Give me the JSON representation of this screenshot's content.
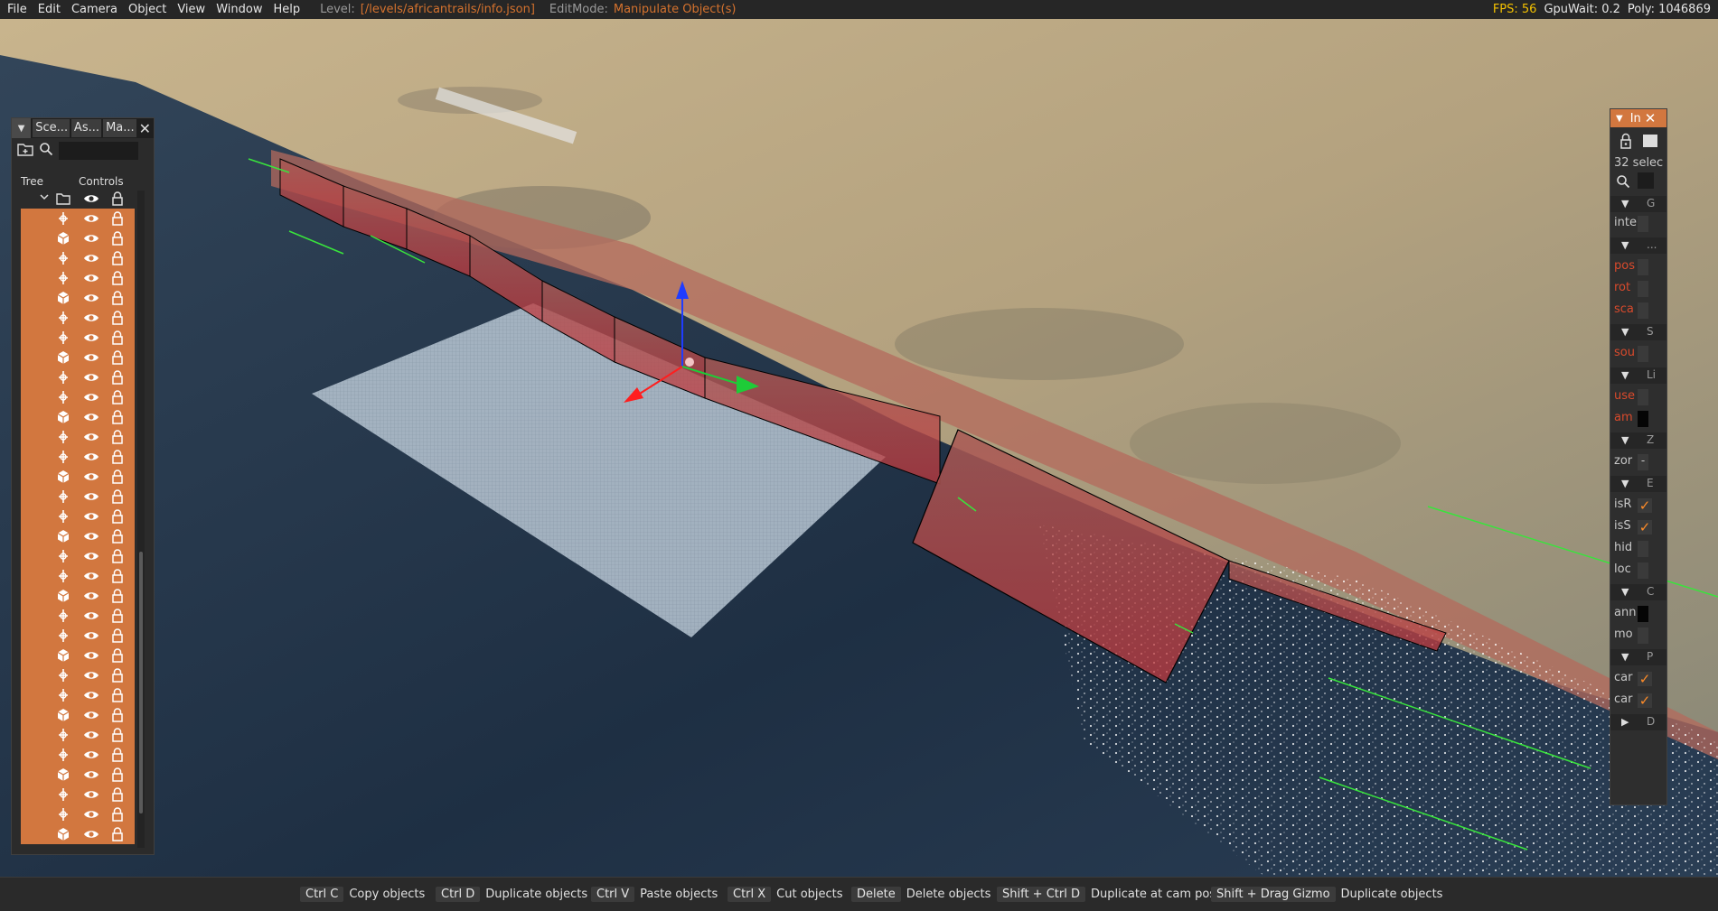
{
  "menu": {
    "items": [
      "File",
      "Edit",
      "Camera",
      "Object",
      "View",
      "Window",
      "Help"
    ],
    "level_label": "Level:",
    "level_value": "[/levels/africantrails/info.json]",
    "editmode_label": "EditMode:",
    "editmode_value": "Manipulate Object(s)"
  },
  "stats": {
    "fps_label": "FPS: 56",
    "gpuwait": "GpuWait: 0.2",
    "poly": "Poly: 1046869"
  },
  "scene_tree": {
    "tabs": [
      "Sce...",
      "As...",
      "Ma..."
    ],
    "columns": [
      "Tree",
      "Controls"
    ],
    "rows": [
      "n",
      "c",
      "n",
      "n",
      "c",
      "n",
      "n",
      "c",
      "n",
      "n",
      "c",
      "n",
      "n",
      "c",
      "n",
      "n",
      "c",
      "n",
      "n",
      "c",
      "n",
      "n",
      "c",
      "n",
      "n",
      "c",
      "n",
      "n",
      "c",
      "n",
      "n",
      "c"
    ]
  },
  "inspector": {
    "title": "In",
    "selection_text": "32 selec",
    "sections": [
      "G",
      "...",
      "S",
      "Li",
      "Z",
      "E",
      "C",
      "P",
      "D"
    ],
    "fields": {
      "inte": "inte",
      "pos": "pos",
      "rot": "rot",
      "sca": "sca",
      "sou": "sou",
      "use": "use",
      "am": "am",
      "zor": "zor",
      "zor_value": "-",
      "isR": "isR",
      "isS": "isS",
      "hid": "hid",
      "loc": "loc",
      "ann": "ann",
      "mo": "mo",
      "car1": "car",
      "car2": "car"
    }
  },
  "shortcuts": [
    {
      "key": "Ctrl C",
      "desc": "Copy objects"
    },
    {
      "key": "Ctrl D",
      "desc": "Duplicate objects"
    },
    {
      "key": "Ctrl V",
      "desc": "Paste objects"
    },
    {
      "key": "Ctrl X",
      "desc": "Cut objects"
    },
    {
      "key": "Delete",
      "desc": "Delete objects"
    },
    {
      "key": "Shift + Ctrl D",
      "desc": "Duplicate at cam pos"
    },
    {
      "key": "Shift + Drag Gizmo",
      "desc": "Duplicate objects"
    }
  ],
  "colors": {
    "accent": "#d2773f",
    "fps": "#f3c000",
    "level": "#d4722e",
    "panel": "#2b2b2b",
    "sand": "#b9a685",
    "water": "#22344a"
  },
  "icons": {
    "tree_arrow": "chevron-down-icon",
    "folder": "folder-icon",
    "eye": "eye-icon",
    "lock": "lock-icon",
    "search": "search-icon",
    "new_group": "new-folder-icon"
  }
}
